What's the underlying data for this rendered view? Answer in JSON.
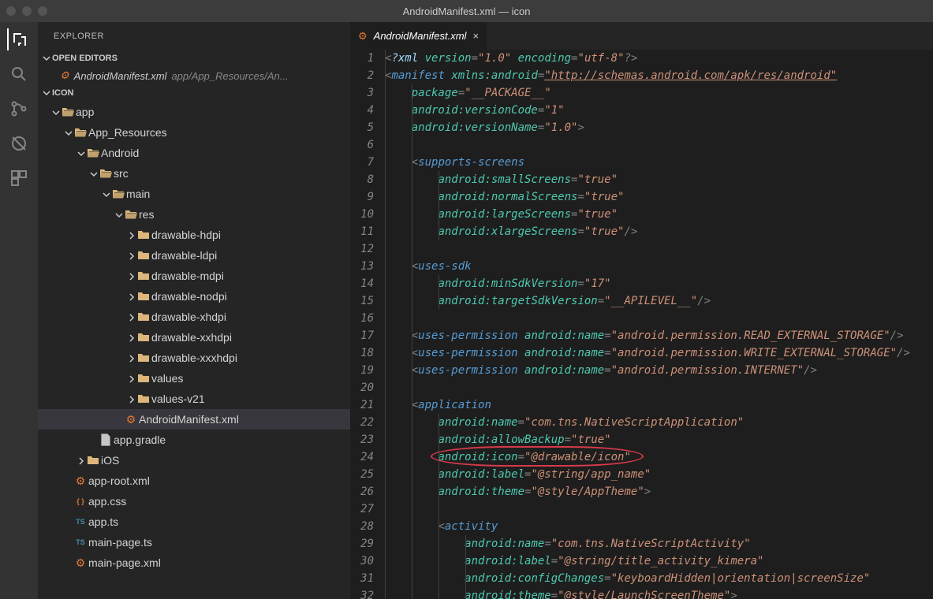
{
  "window": {
    "title": "AndroidManifest.xml — icon"
  },
  "sidebar": {
    "title": "EXPLORER",
    "openEditors": {
      "label": "OPEN EDITORS"
    },
    "openEditorItem": {
      "name": "AndroidManifest.xml",
      "path": "app/App_Resources/An..."
    },
    "rootSection": {
      "label": "ICON"
    },
    "tree": {
      "app": "app",
      "appResources": "App_Resources",
      "android": "Android",
      "src": "src",
      "main": "main",
      "res": "res",
      "drawableHdpi": "drawable-hdpi",
      "drawableLdpi": "drawable-ldpi",
      "drawableMdpi": "drawable-mdpi",
      "drawableNodpi": "drawable-nodpi",
      "drawableXhdpi": "drawable-xhdpi",
      "drawableXxhdpi": "drawable-xxhdpi",
      "drawableXxxhdpi": "drawable-xxxhdpi",
      "values": "values",
      "valuesV21": "values-v21",
      "manifest": "AndroidManifest.xml",
      "appGradle": "app.gradle",
      "ios": "iOS",
      "appRoot": "app-root.xml",
      "appCss": "app.css",
      "appTs": "app.ts",
      "mainPageTs": "main-page.ts",
      "mainPageXml": "main-page.xml"
    }
  },
  "tab": {
    "title": "AndroidManifest.xml"
  },
  "code": {
    "lines": [
      {
        "n": 1,
        "indents": [
          0
        ],
        "html": "<span class='tok-punct'>&lt;</span><span class='tok-attr'>?xml </span><span class='tok-ns'>version</span><span class='tok-punct'>=</span><span class='tok-str'>\"1.0\"</span> <span class='tok-ns'>encoding</span><span class='tok-punct'>=</span><span class='tok-str'>\"utf-8\"</span><span class='tok-punct'>?&gt;</span>"
      },
      {
        "n": 2,
        "indents": [
          0
        ],
        "html": "<span class='tok-punct'>&lt;</span><span class='tok-tag'>manifest</span> <span class='tok-ns'>xmlns:android</span><span class='tok-punct'>=</span><span class='tok-link'>\"http://schemas.android.com/apk/res/android\"</span>"
      },
      {
        "n": 3,
        "indents": [
          0,
          1
        ],
        "html": "    <span class='tok-ns'>package</span><span class='tok-punct'>=</span><span class='tok-str'>\"__PACKAGE__\"</span>"
      },
      {
        "n": 4,
        "indents": [
          0,
          1
        ],
        "html": "    <span class='tok-ns'>android:versionCode</span><span class='tok-punct'>=</span><span class='tok-str'>\"1\"</span>"
      },
      {
        "n": 5,
        "indents": [
          0,
          1
        ],
        "html": "    <span class='tok-ns'>android:versionName</span><span class='tok-punct'>=</span><span class='tok-str'>\"1.0\"</span><span class='tok-punct'>&gt;</span>"
      },
      {
        "n": 6,
        "indents": [
          0,
          1
        ],
        "html": ""
      },
      {
        "n": 7,
        "indents": [
          0,
          1
        ],
        "html": "    <span class='tok-punct'>&lt;</span><span class='tok-tag'>supports-screens</span>"
      },
      {
        "n": 8,
        "indents": [
          0,
          1,
          2
        ],
        "html": "        <span class='tok-ns'>android:smallScreens</span><span class='tok-punct'>=</span><span class='tok-str'>\"true\"</span>"
      },
      {
        "n": 9,
        "indents": [
          0,
          1,
          2
        ],
        "html": "        <span class='tok-ns'>android:normalScreens</span><span class='tok-punct'>=</span><span class='tok-str'>\"true\"</span>"
      },
      {
        "n": 10,
        "indents": [
          0,
          1,
          2
        ],
        "html": "        <span class='tok-ns'>android:largeScreens</span><span class='tok-punct'>=</span><span class='tok-str'>\"true\"</span>"
      },
      {
        "n": 11,
        "indents": [
          0,
          1,
          2
        ],
        "html": "        <span class='tok-ns'>android:xlargeScreens</span><span class='tok-punct'>=</span><span class='tok-str'>\"true\"</span><span class='tok-punct'>/&gt;</span>"
      },
      {
        "n": 12,
        "indents": [
          0,
          1
        ],
        "html": ""
      },
      {
        "n": 13,
        "indents": [
          0,
          1
        ],
        "html": "    <span class='tok-punct'>&lt;</span><span class='tok-tag'>uses-sdk</span>"
      },
      {
        "n": 14,
        "indents": [
          0,
          1,
          2
        ],
        "html": "        <span class='tok-ns'>android:minSdkVersion</span><span class='tok-punct'>=</span><span class='tok-str'>\"17\"</span>"
      },
      {
        "n": 15,
        "indents": [
          0,
          1,
          2
        ],
        "html": "        <span class='tok-ns'>android:targetSdkVersion</span><span class='tok-punct'>=</span><span class='tok-str'>\"__APILEVEL__\"</span><span class='tok-punct'>/&gt;</span>"
      },
      {
        "n": 16,
        "indents": [
          0,
          1
        ],
        "html": ""
      },
      {
        "n": 17,
        "indents": [
          0,
          1
        ],
        "html": "    <span class='tok-punct'>&lt;</span><span class='tok-tag'>uses-permission</span> <span class='tok-ns'>android:name</span><span class='tok-punct'>=</span><span class='tok-str'>\"android.permission.READ_EXTERNAL_STORAGE\"</span><span class='tok-punct'>/&gt;</span>"
      },
      {
        "n": 18,
        "indents": [
          0,
          1
        ],
        "html": "    <span class='tok-punct'>&lt;</span><span class='tok-tag'>uses-permission</span> <span class='tok-ns'>android:name</span><span class='tok-punct'>=</span><span class='tok-str'>\"android.permission.WRITE_EXTERNAL_STORAGE\"</span><span class='tok-punct'>/&gt;</span>"
      },
      {
        "n": 19,
        "indents": [
          0,
          1
        ],
        "html": "    <span class='tok-punct'>&lt;</span><span class='tok-tag'>uses-permission</span> <span class='tok-ns'>android:name</span><span class='tok-punct'>=</span><span class='tok-str'>\"android.permission.INTERNET\"</span><span class='tok-punct'>/&gt;</span>"
      },
      {
        "n": 20,
        "indents": [
          0,
          1
        ],
        "html": ""
      },
      {
        "n": 21,
        "indents": [
          0,
          1
        ],
        "html": "    <span class='tok-punct'>&lt;</span><span class='tok-tag'>application</span>"
      },
      {
        "n": 22,
        "indents": [
          0,
          1,
          2
        ],
        "html": "        <span class='tok-ns'>android:name</span><span class='tok-punct'>=</span><span class='tok-str'>\"com.tns.NativeScriptApplication\"</span>"
      },
      {
        "n": 23,
        "indents": [
          0,
          1,
          2
        ],
        "html": "        <span class='tok-ns'>android:allowBackup</span><span class='tok-punct'>=</span><span class='tok-str'>\"true\"</span>"
      },
      {
        "n": 24,
        "indents": [
          0,
          1,
          2
        ],
        "html": "        <span class='tok-ns'>android:icon</span><span class='tok-punct'>=</span><span class='tok-str'>\"@drawable/icon\"</span>",
        "highlight": true
      },
      {
        "n": 25,
        "indents": [
          0,
          1,
          2
        ],
        "html": "        <span class='tok-ns'>android:label</span><span class='tok-punct'>=</span><span class='tok-str'>\"@string/app_name\"</span>"
      },
      {
        "n": 26,
        "indents": [
          0,
          1,
          2
        ],
        "html": "        <span class='tok-ns'>android:theme</span><span class='tok-punct'>=</span><span class='tok-str'>\"@style/AppTheme\"</span><span class='tok-punct'>&gt;</span>"
      },
      {
        "n": 27,
        "indents": [
          0,
          1,
          2
        ],
        "html": ""
      },
      {
        "n": 28,
        "indents": [
          0,
          1,
          2
        ],
        "html": "        <span class='tok-punct'>&lt;</span><span class='tok-tag'>activity</span>"
      },
      {
        "n": 29,
        "indents": [
          0,
          1,
          2,
          3
        ],
        "html": "            <span class='tok-ns'>android:name</span><span class='tok-punct'>=</span><span class='tok-str'>\"com.tns.NativeScriptActivity\"</span>"
      },
      {
        "n": 30,
        "indents": [
          0,
          1,
          2,
          3
        ],
        "html": "            <span class='tok-ns'>android:label</span><span class='tok-punct'>=</span><span class='tok-str'>\"@string/title_activity_kimera\"</span>"
      },
      {
        "n": 31,
        "indents": [
          0,
          1,
          2,
          3
        ],
        "html": "            <span class='tok-ns'>android:configChanges</span><span class='tok-punct'>=</span><span class='tok-str'>\"keyboardHidden|orientation|screenSize\"</span>"
      },
      {
        "n": 32,
        "indents": [
          0,
          1,
          2,
          3
        ],
        "html": "            <span class='tok-ns'>android:theme</span><span class='tok-punct'>=</span><span class='tok-str'>\"@style/LaunchScreenTheme\"</span><span class='tok-punct'>&gt;</span>"
      }
    ]
  }
}
